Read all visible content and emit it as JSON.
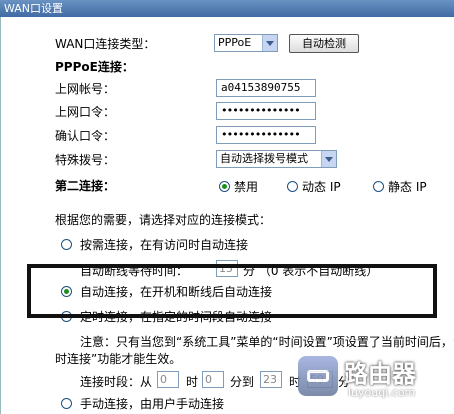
{
  "window": {
    "title": "WAN口设置"
  },
  "wan_type": {
    "label": "WAN口连接类型：",
    "value": "PPPoE",
    "detect_button": "自动检测"
  },
  "pppoe": {
    "section_label": "PPPoE连接：",
    "account_label": "上网帐号：",
    "account_value": "a04153890755",
    "password_label": "上网口令：",
    "password_value": "••••••••••••••",
    "confirm_label": "确认口令：",
    "confirm_value": "••••••••••••••",
    "dial_label": "特殊拨号：",
    "dial_value": "自动选择拨号模式"
  },
  "second_conn": {
    "label": "第二连接：",
    "options": [
      "禁用",
      "动态 IP",
      "静态 IP"
    ],
    "selected": 0
  },
  "mode": {
    "intro": "根据您的需要，请选择对应的连接模式：",
    "on_demand": "按需连接，在有访问时自动连接",
    "idle_prefix": "自动断线等待时间：",
    "idle_value": "15",
    "idle_suffix": "分 （0 表示不自动断线）",
    "auto": "自动连接，在开机和断线后自动连接",
    "timed": "定时连接，在指定的时间段自动连接",
    "note_line1": "注意：只有当您到“系统工具”菜单的“时间设置”项设置了当前时间后，“定",
    "note_line2": "时连接”功能才能生效。",
    "period_label": "连接时段：从",
    "from_h": "0",
    "hour1": "时",
    "from_m": "0",
    "to_label": "分到",
    "to_h": "23",
    "hour2": "时",
    "to_m": "59",
    "min_label": "分",
    "manual": "手动连接，由用户手动连接",
    "selected": "auto"
  },
  "watermark": {
    "text": "路由器",
    "sub": "luyouqi.com"
  }
}
